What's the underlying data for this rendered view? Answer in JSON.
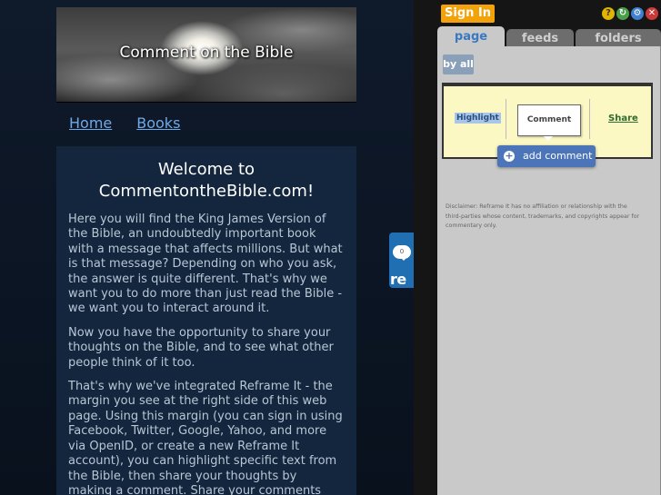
{
  "site": {
    "banner_title": "Comment on the Bible",
    "nav": {
      "home": "Home",
      "books": "Books"
    },
    "welcome_heading": "Welcome to CommentontheBible.com!",
    "paragraphs": [
      "Here you will find the King James Version of the Bible, an undoubtedly important book with a message that affects millions. But what is that message? Depending on who you ask, the answer is quite different. That's why we want you to do more than just read the Bible - we want you to interact around it.",
      "Now you have the opportunity to share your thoughts on the Bible, and to see what other people think of it too.",
      "That's why we've integrated Reframe It - the margin you see at the right side of this web page. Using this margin (you can sign in using Facebook, Twitter, Google, Yahoo, and more via OpenID, or create a new Reframe It account), you can highlight specific text from the Bible, then share your thoughts by making a comment. Share your comments with friends via"
    ]
  },
  "reframe_tab": {
    "count": "0",
    "label": "re"
  },
  "sidebar": {
    "signin_label": "Sign In",
    "icons": [
      "help-icon",
      "refresh-icon",
      "settings-icon",
      "close-icon"
    ],
    "icon_glyphs": {
      "help": "?",
      "refresh": "↻",
      "settings": "⚙",
      "close": "✕"
    },
    "tabs": {
      "page": "page",
      "feeds": "feeds",
      "folders": "folders"
    },
    "filter_label": "by all",
    "hint": {
      "highlight": "Highlight",
      "comment": "Comment",
      "share": "Share"
    },
    "add_comment_label": "add comment",
    "disclaimer": "Disclaimer: Reframe It has no affiliation or relationship with the third-parties whose content, trademarks, and copyrights appear for commentary only."
  },
  "colors": {
    "signin": "#f3a20a",
    "link": "#6fa9e8",
    "content_bg": "#13263e",
    "add_comment": "#4c74b8",
    "hint_bg": "#fbf8c4"
  }
}
